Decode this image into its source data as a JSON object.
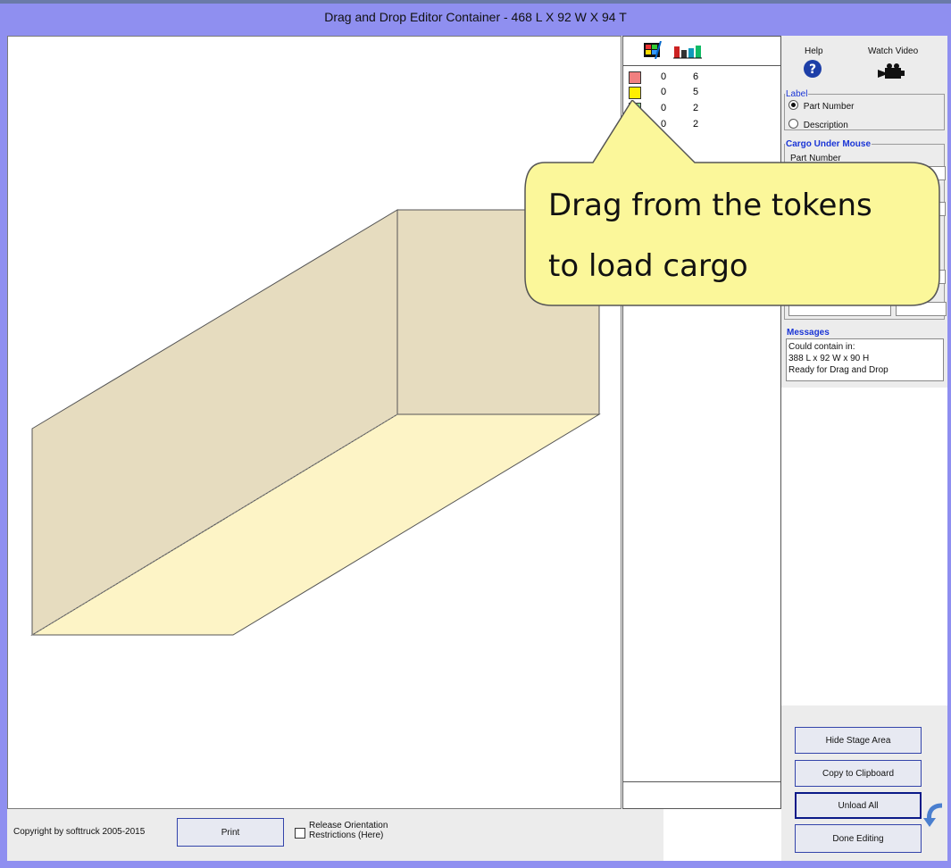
{
  "window": {
    "title": "Drag and Drop Editor     Container - 468 L X 92 W X 94 T"
  },
  "colors": {
    "frame": "#8f8ff0",
    "box_side": "#e6dcbf",
    "box_floor": "#fdf4c6",
    "callout_fill": "#fbf79a",
    "accent_blue": "#1a35d6"
  },
  "tokens": {
    "header_icons": [
      "stack-icon",
      "bar-chart-icon"
    ],
    "items": [
      {
        "color": "#f08080",
        "col1": "0",
        "col2": "6"
      },
      {
        "color": "#ffee00",
        "col1": "0",
        "col2": "5"
      },
      {
        "color": "#88dd88",
        "col1": "0",
        "col2": "2"
      },
      {
        "color": "#88bbee",
        "col1": "0",
        "col2": "2"
      }
    ]
  },
  "right_panel": {
    "help_label": "Help",
    "watch_video_label": "Watch Video",
    "label_group": {
      "title": "Label",
      "options": [
        "Part Number",
        "Description"
      ],
      "selected": "Part Number"
    },
    "cargo_group": {
      "title": "Cargo Under Mouse",
      "part_number_label": "Part Number"
    },
    "messages": {
      "title": "Messages",
      "lines": [
        "Could contain in:",
        "388 L x 92 W x 90 H",
        "Ready for Drag and Drop"
      ]
    },
    "buttons": {
      "hide_stage": "Hide Stage Area",
      "copy": "Copy to Clipboard",
      "unload": "Unload All",
      "done": "Done Editing"
    }
  },
  "bottom_bar": {
    "copyright": "Copyright by softtruck 2005-2015",
    "print": "Print",
    "release_line1": "Release Orientation",
    "release_line2": "Restrictions (Here)"
  },
  "callout": {
    "line1": "Drag from the tokens",
    "line2": "to load cargo"
  }
}
